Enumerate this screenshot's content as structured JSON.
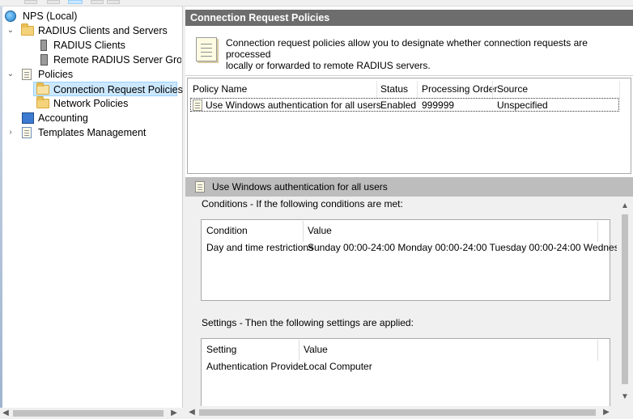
{
  "tree": {
    "items": [
      {
        "label": "NPS (Local)",
        "icon": "globe-icon",
        "chevron": ""
      },
      {
        "label": "RADIUS Clients and Servers",
        "icon": "folder-icon",
        "chevron": "expanded"
      },
      {
        "label": "RADIUS Clients",
        "icon": "server-icon",
        "chevron": ""
      },
      {
        "label": "Remote RADIUS Server Groups",
        "icon": "server-group-icon",
        "chevron": ""
      },
      {
        "label": "Policies",
        "icon": "policy-doc-icon",
        "chevron": "expanded"
      },
      {
        "label": "Connection Request Policies",
        "icon": "open-folder-icon",
        "chevron": "",
        "selected": true
      },
      {
        "label": "Network Policies",
        "icon": "folder-icon",
        "chevron": ""
      },
      {
        "label": "Accounting",
        "icon": "accounting-icon",
        "chevron": ""
      },
      {
        "label": "Templates Management",
        "icon": "templates-icon",
        "chevron": "collapsed"
      }
    ]
  },
  "header": {
    "title": "Connection Request Policies"
  },
  "description": {
    "line1": "Connection request policies allow you to designate whether connection requests are processed",
    "line2": "locally or forwarded to remote RADIUS servers."
  },
  "policy_table": {
    "columns": [
      "Policy Name",
      "Status",
      "Processing Order",
      "Source"
    ],
    "rows": [
      {
        "name": "Use Windows authentication for all users",
        "status": "Enabled",
        "order": "999999",
        "source": "Unspecified"
      }
    ]
  },
  "detail": {
    "title": "Use Windows authentication for all users",
    "conditions_label": "Conditions - If the following conditions are met:",
    "conditions_columns": [
      "Condition",
      "Value"
    ],
    "conditions_rows": [
      {
        "condition": "Day and time restrictions",
        "value": "Sunday 00:00-24:00 Monday 00:00-24:00 Tuesday 00:00-24:00 Wednes..."
      }
    ],
    "settings_label": "Settings - Then the following settings are applied:",
    "settings_columns": [
      "Setting",
      "Value"
    ],
    "settings_rows": [
      {
        "setting": "Authentication Provider",
        "value": "Local Computer"
      }
    ]
  },
  "colors": {
    "header_bg": "#6d6d6d",
    "detail_header_bg": "#bdbdbd",
    "selection": "#cce8ff"
  }
}
